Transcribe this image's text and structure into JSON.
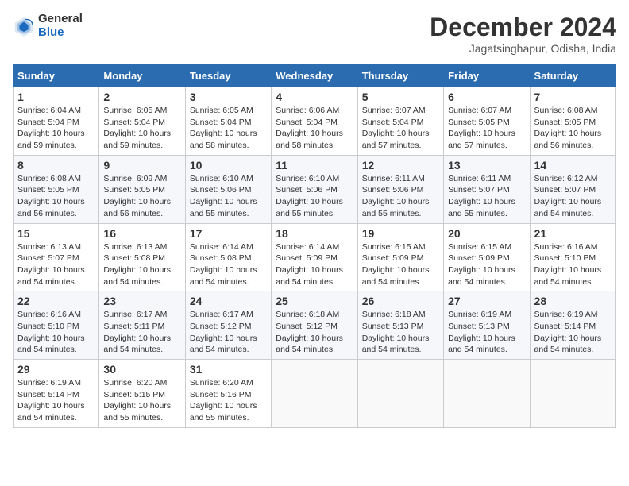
{
  "header": {
    "logo_general": "General",
    "logo_blue": "Blue",
    "title": "December 2024",
    "subtitle": "Jagatsinghapur, Odisha, India"
  },
  "weekdays": [
    "Sunday",
    "Monday",
    "Tuesday",
    "Wednesday",
    "Thursday",
    "Friday",
    "Saturday"
  ],
  "weeks": [
    [
      {
        "day": "1",
        "sunrise": "6:04 AM",
        "sunset": "5:04 PM",
        "daylight": "10 hours and 59 minutes."
      },
      {
        "day": "2",
        "sunrise": "6:05 AM",
        "sunset": "5:04 PM",
        "daylight": "10 hours and 59 minutes."
      },
      {
        "day": "3",
        "sunrise": "6:05 AM",
        "sunset": "5:04 PM",
        "daylight": "10 hours and 58 minutes."
      },
      {
        "day": "4",
        "sunrise": "6:06 AM",
        "sunset": "5:04 PM",
        "daylight": "10 hours and 58 minutes."
      },
      {
        "day": "5",
        "sunrise": "6:07 AM",
        "sunset": "5:04 PM",
        "daylight": "10 hours and 57 minutes."
      },
      {
        "day": "6",
        "sunrise": "6:07 AM",
        "sunset": "5:05 PM",
        "daylight": "10 hours and 57 minutes."
      },
      {
        "day": "7",
        "sunrise": "6:08 AM",
        "sunset": "5:05 PM",
        "daylight": "10 hours and 56 minutes."
      }
    ],
    [
      {
        "day": "8",
        "sunrise": "6:08 AM",
        "sunset": "5:05 PM",
        "daylight": "10 hours and 56 minutes."
      },
      {
        "day": "9",
        "sunrise": "6:09 AM",
        "sunset": "5:05 PM",
        "daylight": "10 hours and 56 minutes."
      },
      {
        "day": "10",
        "sunrise": "6:10 AM",
        "sunset": "5:06 PM",
        "daylight": "10 hours and 55 minutes."
      },
      {
        "day": "11",
        "sunrise": "6:10 AM",
        "sunset": "5:06 PM",
        "daylight": "10 hours and 55 minutes."
      },
      {
        "day": "12",
        "sunrise": "6:11 AM",
        "sunset": "5:06 PM",
        "daylight": "10 hours and 55 minutes."
      },
      {
        "day": "13",
        "sunrise": "6:11 AM",
        "sunset": "5:07 PM",
        "daylight": "10 hours and 55 minutes."
      },
      {
        "day": "14",
        "sunrise": "6:12 AM",
        "sunset": "5:07 PM",
        "daylight": "10 hours and 54 minutes."
      }
    ],
    [
      {
        "day": "15",
        "sunrise": "6:13 AM",
        "sunset": "5:07 PM",
        "daylight": "10 hours and 54 minutes."
      },
      {
        "day": "16",
        "sunrise": "6:13 AM",
        "sunset": "5:08 PM",
        "daylight": "10 hours and 54 minutes."
      },
      {
        "day": "17",
        "sunrise": "6:14 AM",
        "sunset": "5:08 PM",
        "daylight": "10 hours and 54 minutes."
      },
      {
        "day": "18",
        "sunrise": "6:14 AM",
        "sunset": "5:09 PM",
        "daylight": "10 hours and 54 minutes."
      },
      {
        "day": "19",
        "sunrise": "6:15 AM",
        "sunset": "5:09 PM",
        "daylight": "10 hours and 54 minutes."
      },
      {
        "day": "20",
        "sunrise": "6:15 AM",
        "sunset": "5:09 PM",
        "daylight": "10 hours and 54 minutes."
      },
      {
        "day": "21",
        "sunrise": "6:16 AM",
        "sunset": "5:10 PM",
        "daylight": "10 hours and 54 minutes."
      }
    ],
    [
      {
        "day": "22",
        "sunrise": "6:16 AM",
        "sunset": "5:10 PM",
        "daylight": "10 hours and 54 minutes."
      },
      {
        "day": "23",
        "sunrise": "6:17 AM",
        "sunset": "5:11 PM",
        "daylight": "10 hours and 54 minutes."
      },
      {
        "day": "24",
        "sunrise": "6:17 AM",
        "sunset": "5:12 PM",
        "daylight": "10 hours and 54 minutes."
      },
      {
        "day": "25",
        "sunrise": "6:18 AM",
        "sunset": "5:12 PM",
        "daylight": "10 hours and 54 minutes."
      },
      {
        "day": "26",
        "sunrise": "6:18 AM",
        "sunset": "5:13 PM",
        "daylight": "10 hours and 54 minutes."
      },
      {
        "day": "27",
        "sunrise": "6:19 AM",
        "sunset": "5:13 PM",
        "daylight": "10 hours and 54 minutes."
      },
      {
        "day": "28",
        "sunrise": "6:19 AM",
        "sunset": "5:14 PM",
        "daylight": "10 hours and 54 minutes."
      }
    ],
    [
      {
        "day": "29",
        "sunrise": "6:19 AM",
        "sunset": "5:14 PM",
        "daylight": "10 hours and 54 minutes."
      },
      {
        "day": "30",
        "sunrise": "6:20 AM",
        "sunset": "5:15 PM",
        "daylight": "10 hours and 55 minutes."
      },
      {
        "day": "31",
        "sunrise": "6:20 AM",
        "sunset": "5:16 PM",
        "daylight": "10 hours and 55 minutes."
      },
      null,
      null,
      null,
      null
    ]
  ],
  "labels": {
    "sunrise": "Sunrise:",
    "sunset": "Sunset:",
    "daylight": "Daylight:"
  }
}
